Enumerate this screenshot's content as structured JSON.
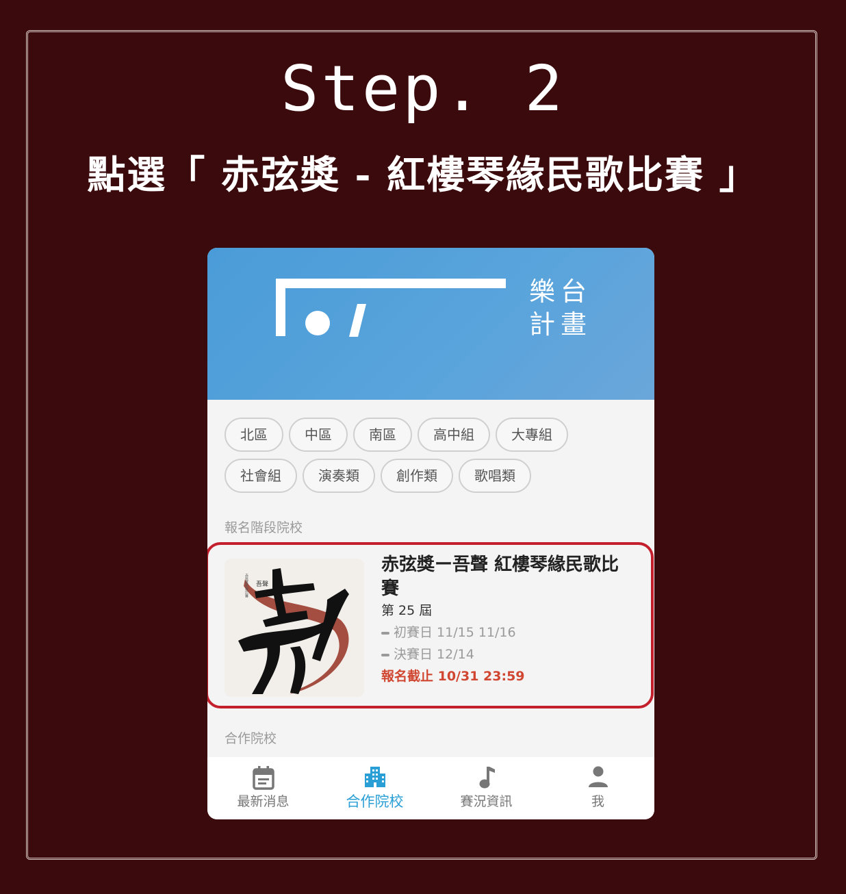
{
  "header": {
    "step_title": "Step. 2",
    "instruction": "點選「 赤弦獎 - 紅樓琴緣民歌比賽 」"
  },
  "app": {
    "logo_text_line1": "樂台",
    "logo_text_line2": "計畫",
    "filter_chips": [
      {
        "label": "北區"
      },
      {
        "label": "中區"
      },
      {
        "label": "南區"
      },
      {
        "label": "高中組"
      },
      {
        "label": "大專組"
      },
      {
        "label": "社會組"
      },
      {
        "label": "演奏類"
      },
      {
        "label": "創作類"
      },
      {
        "label": "歌唱類"
      }
    ],
    "section_registering": "報名階段院校",
    "section_partners": "合作院校",
    "competition_card": {
      "title": "赤弦獎ー吾聲 紅樓琴緣民歌比賽",
      "edition": "第 25 屆",
      "prelim": "初賽日 11/15 11/16",
      "final": "決賽日 12/14",
      "deadline": "報名截止 10/31 23:59",
      "poster_title": "吾聲",
      "poster_subtitle": "赤弦獎民歌比賽"
    },
    "bottom_nav": [
      {
        "label": "最新消息",
        "icon": "calendar-icon",
        "active": false
      },
      {
        "label": "合作院校",
        "icon": "building-icon",
        "active": true
      },
      {
        "label": "賽況資訊",
        "icon": "music-note-icon",
        "active": false
      },
      {
        "label": "我",
        "icon": "person-icon",
        "active": false
      }
    ]
  },
  "colors": {
    "background": "#3a0a0d",
    "hero_blue": "#5aa4dc",
    "highlight_red": "#c31f2c",
    "deadline_red": "#d04631",
    "nav_active": "#2a9fd6"
  }
}
